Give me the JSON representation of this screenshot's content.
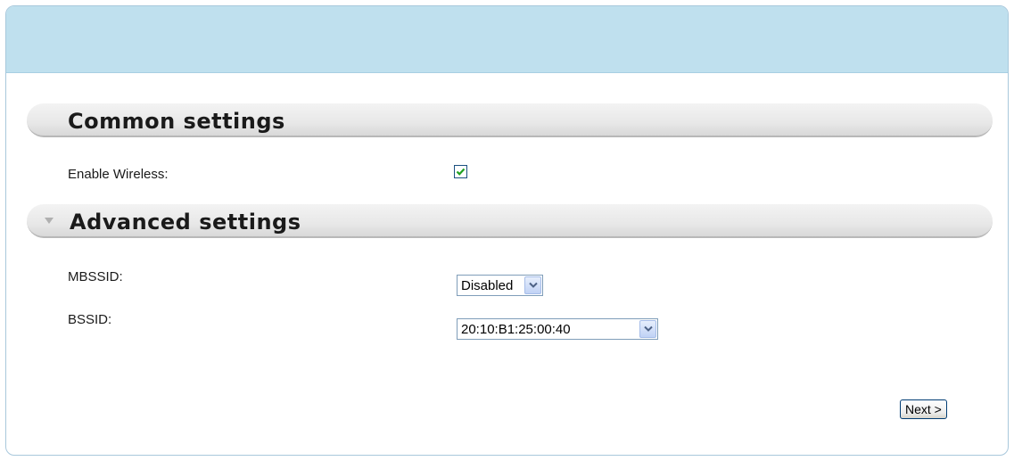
{
  "common_section": {
    "title": "Common settings",
    "enable_wireless_label": "Enable Wireless:",
    "enable_wireless_checked": true
  },
  "advanced_section": {
    "title": "Advanced settings",
    "mbssid_label": "MBSSID:",
    "mbssid_value": "Disabled",
    "bssid_label": "BSSID:",
    "bssid_value": "20:10:B1:25:00:40"
  },
  "actions": {
    "next_label": "Next >"
  },
  "icons": {
    "checkmark": "checkmark-icon",
    "dropdown": "chevron-down-icon",
    "collapse": "collapse-triangle-icon"
  },
  "colors": {
    "header_bg": "#bfe0ee",
    "check_green": "#21a121"
  }
}
